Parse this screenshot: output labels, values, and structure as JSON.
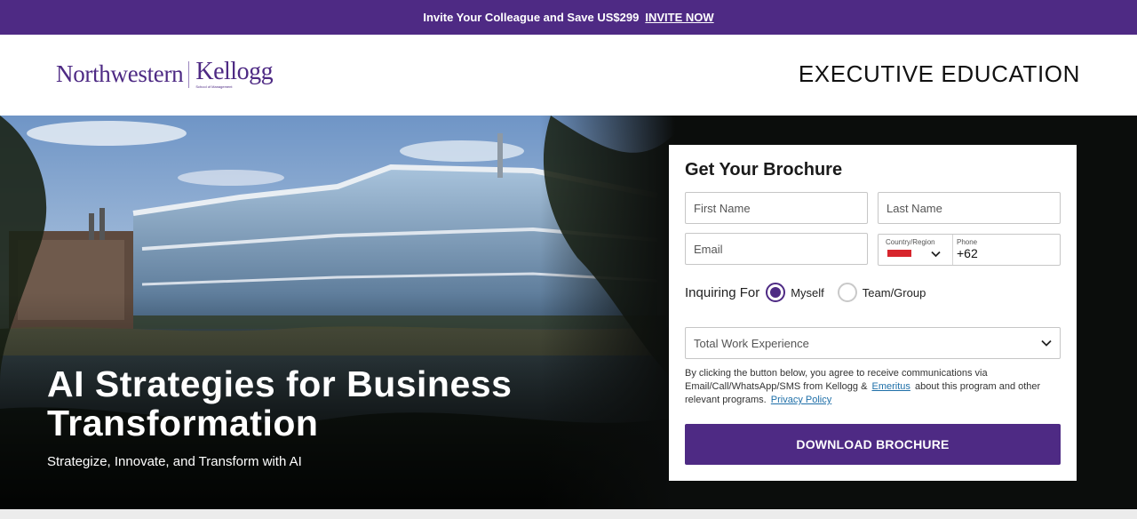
{
  "promo": {
    "text": "Invite Your Colleague and Save US$299",
    "cta": "INVITE NOW"
  },
  "header": {
    "logo_primary": "Northwestern",
    "logo_secondary": "Kellogg",
    "logo_tagline": "School of Management",
    "section_title": "EXECUTIVE EDUCATION"
  },
  "hero": {
    "title": "AI Strategies for Business Transformation",
    "subtitle": "Strategize, Innovate, and Transform with AI"
  },
  "form": {
    "title": "Get Your Brochure",
    "first_name_placeholder": "First Name",
    "last_name_placeholder": "Last Name",
    "email_placeholder": "Email",
    "country_label": "Country/Region",
    "phone_label": "Phone",
    "phone_code": "+62",
    "inquiring_label": "Inquiring For",
    "option_myself": "Myself",
    "option_team": "Team/Group",
    "selected_option": "Myself",
    "work_experience_placeholder": "Total Work Experience",
    "consent_before": "By clicking the button below, you agree to receive communications via Email/Call/WhatsApp/SMS from Kellogg &",
    "consent_link": "Emeritus",
    "consent_after": "about this program and other relevant programs.",
    "privacy_link": "Privacy Policy",
    "submit_label": "DOWNLOAD BROCHURE"
  },
  "colors": {
    "brand_purple": "#4e2a84",
    "link_blue": "#1e6fa8",
    "flag_red": "#d7262d"
  },
  "icons": {
    "country_dropdown": "chevron-down-icon",
    "experience_dropdown": "chevron-down-icon"
  }
}
